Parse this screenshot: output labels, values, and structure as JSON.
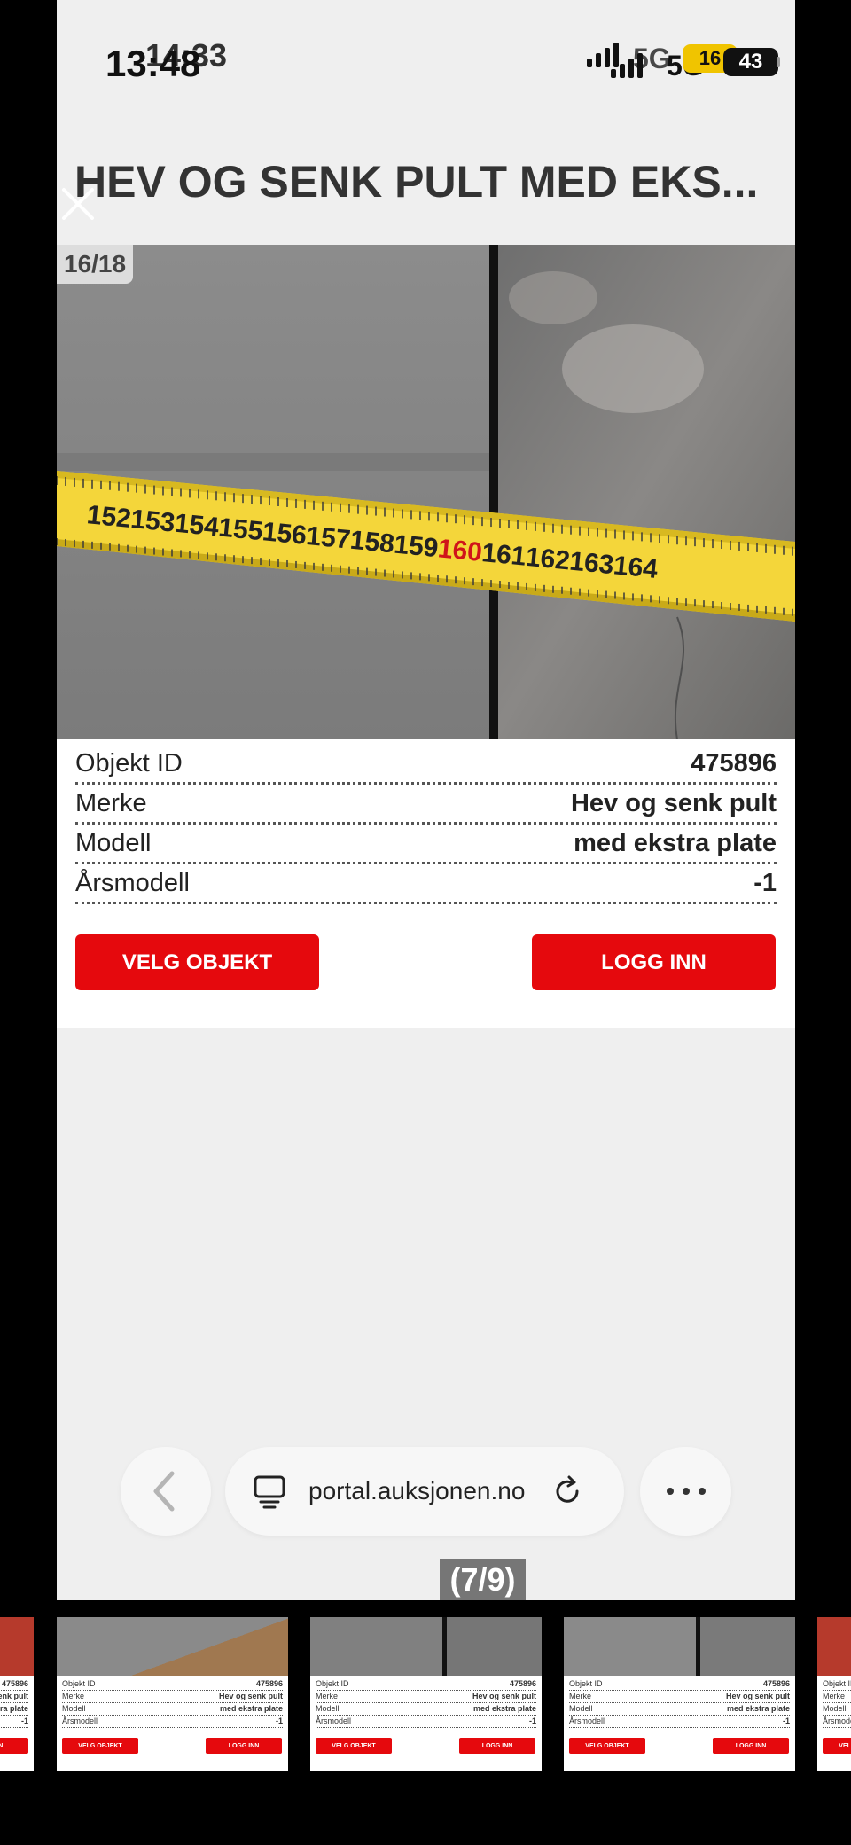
{
  "status_bar": {
    "time_primary": "13:48",
    "time_overlay": "14:33",
    "network_primary": "5G",
    "network_overlay": "5G",
    "battery_primary": "43",
    "battery_overlay": "16"
  },
  "header": {
    "title": "HEV OG SENK PULT MED EKS..."
  },
  "photo": {
    "counter": "16/18"
  },
  "details": {
    "rows": [
      {
        "label": "Objekt ID",
        "value": "475896"
      },
      {
        "label": "Merke",
        "value": "Hev og senk pult"
      },
      {
        "label": "Modell",
        "value": "med ekstra plate"
      },
      {
        "label": "Årsmodell",
        "value": "-1"
      }
    ],
    "select_button": "VELG OBJEKT",
    "login_button": "LOGG INN"
  },
  "browser": {
    "url": "portal.auksjonen.no"
  },
  "pager": "(7/9)",
  "tape_numbers": [
    "152",
    "153",
    "154",
    "155",
    "156",
    "157",
    "158",
    "159",
    "160",
    "161",
    "162",
    "163",
    "164"
  ],
  "colors": {
    "accent": "#e5090d",
    "tape": "#f4d63a"
  },
  "thumbnails": {
    "rows": [
      {
        "label": "Objekt ID",
        "value": "475896"
      },
      {
        "label": "Merke",
        "value": "Hev og senk pult"
      },
      {
        "label": "Modell",
        "value": "med ekstra plate"
      },
      {
        "label": "Årsmodell",
        "value": "-1"
      }
    ],
    "select_button": "VELG OBJEKT",
    "login_button": "LOGG INN"
  }
}
